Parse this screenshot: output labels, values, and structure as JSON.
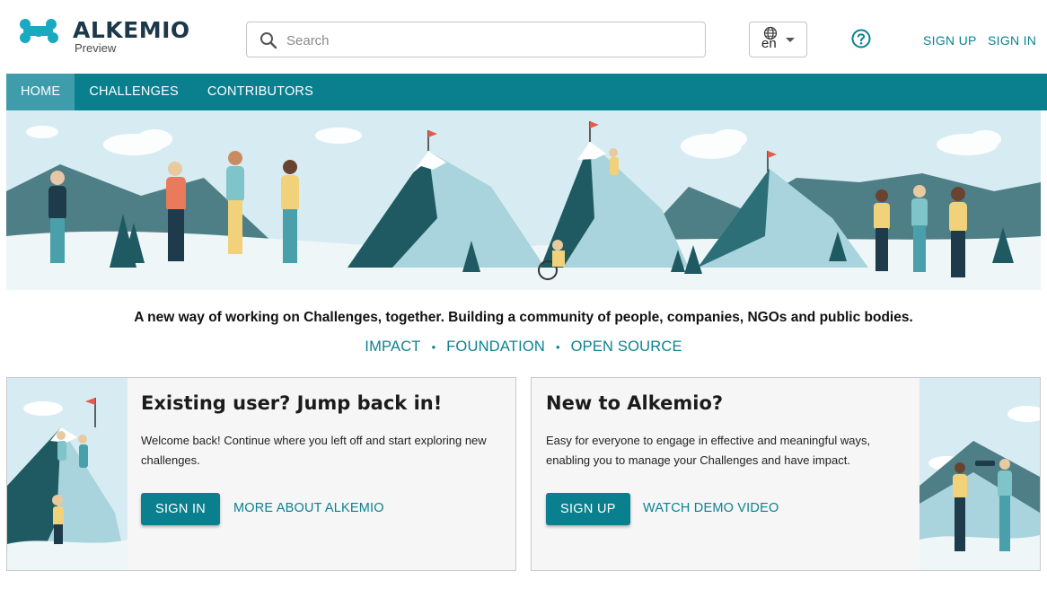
{
  "brand": {
    "name": "ALKEMIO",
    "subtitle": "Preview",
    "logo_icon": "alkemio-logo-icon"
  },
  "search": {
    "placeholder": "Search",
    "value": ""
  },
  "language": {
    "selected": "en"
  },
  "header_links": {
    "sign_up": "SIGN UP",
    "sign_in": "SIGN IN"
  },
  "nav": {
    "items": [
      {
        "label": "HOME",
        "active": true
      },
      {
        "label": "CHALLENGES",
        "active": false
      },
      {
        "label": "CONTRIBUTORS",
        "active": false
      }
    ]
  },
  "tagline": "A new way of working on Challenges, together. Building a community of people, companies, NGOs and public bodies.",
  "info_links": [
    "IMPACT",
    "FOUNDATION",
    "OPEN SOURCE"
  ],
  "cards": {
    "existing": {
      "title": "Existing user? Jump back in!",
      "text": "Welcome back! Continue where you left off and start exploring new challenges.",
      "primary": "SIGN IN",
      "secondary": "MORE ABOUT ALKEMIO"
    },
    "new": {
      "title": "New to Alkemio?",
      "text": "Easy for everyone to engage in effective and meaningful ways, enabling you to manage your Challenges and have impact.",
      "primary": "SIGN UP",
      "secondary": "WATCH DEMO VIDEO"
    }
  },
  "colors": {
    "primary": "#0a7f8e",
    "nav_active": "#3f9cab",
    "link": "#0a8291",
    "brand_text": "#1d384a"
  }
}
